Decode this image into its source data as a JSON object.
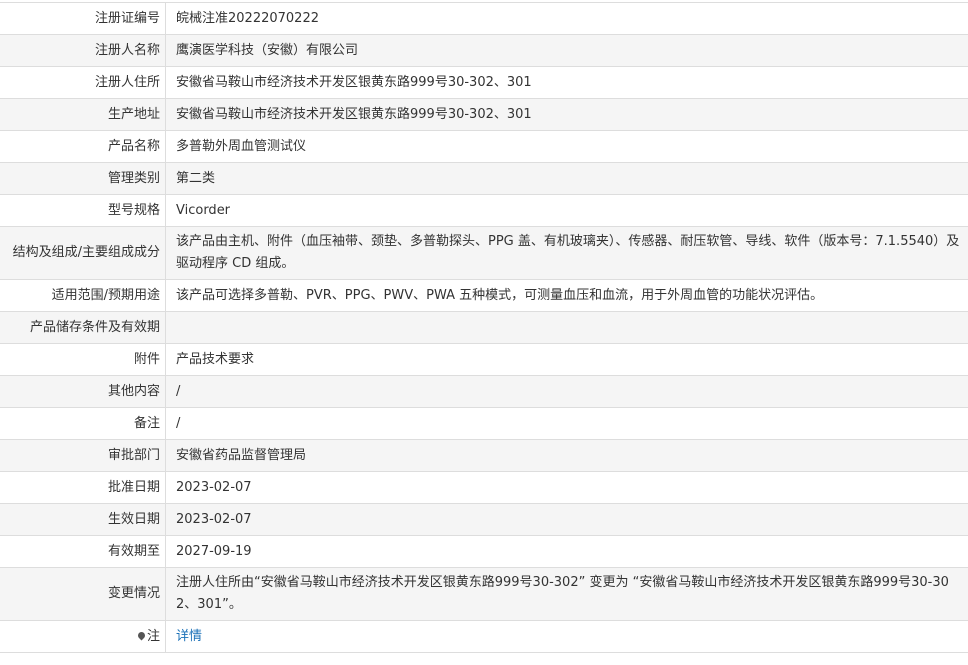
{
  "rows": [
    {
      "label": "注册证编号",
      "value": "皖械注准20222070222"
    },
    {
      "label": "注册人名称",
      "value": "鹰演医学科技（安徽）有限公司"
    },
    {
      "label": "注册人住所",
      "value": "安徽省马鞍山市经济技术开发区银黄东路999号30-302、301"
    },
    {
      "label": "生产地址",
      "value": "安徽省马鞍山市经济技术开发区银黄东路999号30-302、301"
    },
    {
      "label": "产品名称",
      "value": "多普勒外周血管测试仪"
    },
    {
      "label": "管理类别",
      "value": "第二类"
    },
    {
      "label": "型号规格",
      "value": "Vicorder"
    },
    {
      "label": "结构及组成/主要组成成分",
      "value": "该产品由主机、附件（血压袖带、颈垫、多普勒探头、PPG 盖、有机玻璃夹）、传感器、耐压软管、导线、软件（版本号：7.1.5540）及驱动程序 CD 组成。"
    },
    {
      "label": "适用范围/预期用途",
      "value": "该产品可选择多普勒、PVR、PPG、PWV、PWA 五种模式，可测量血压和血流，用于外周血管的功能状况评估。"
    },
    {
      "label": "产品储存条件及有效期",
      "value": ""
    },
    {
      "label": "附件",
      "value": "产品技术要求"
    },
    {
      "label": "其他内容",
      "value": "/"
    },
    {
      "label": "备注",
      "value": "/"
    },
    {
      "label": "审批部门",
      "value": "安徽省药品监督管理局"
    },
    {
      "label": "批准日期",
      "value": "2023-02-07"
    },
    {
      "label": "生效日期",
      "value": "2023-02-07"
    },
    {
      "label": "有效期至",
      "value": "2027-09-19"
    },
    {
      "label": "变更情况",
      "value": "注册人住所由“安徽省马鞍山市经济技术开发区银黄东路999号30-302” 变更为 “安徽省马鞍山市经济技术开发区银黄东路999号30-302、301”。"
    }
  ],
  "note": {
    "label": "注",
    "icon": "location-pin-icon",
    "link_text": "详情"
  }
}
